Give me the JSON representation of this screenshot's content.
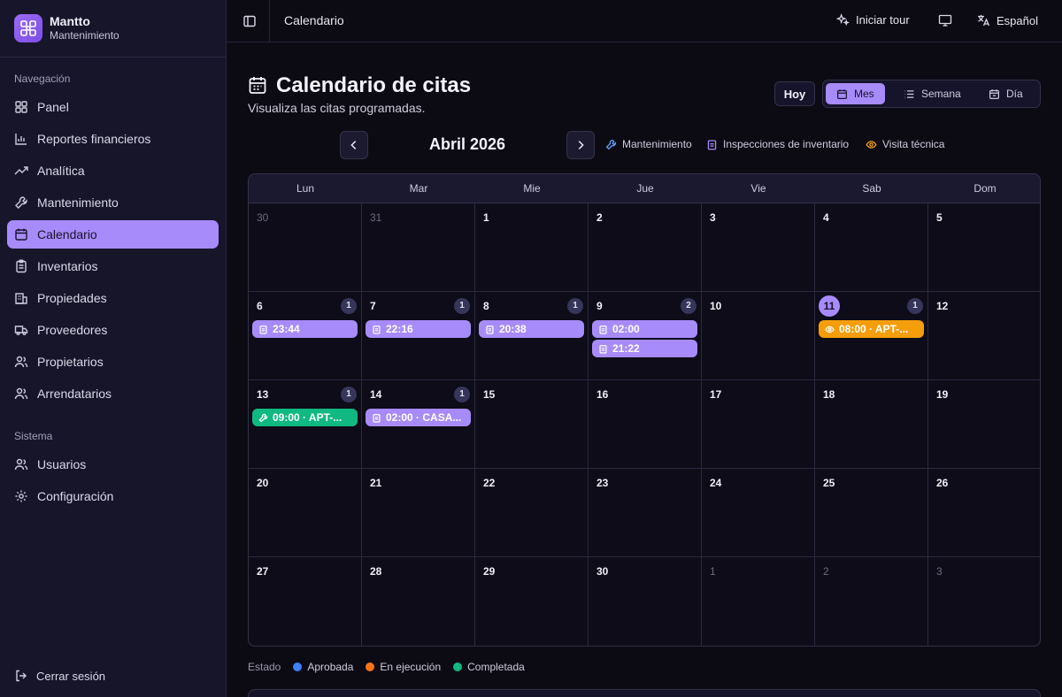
{
  "brand": {
    "name": "Mantto",
    "subtitle": "Mantenimiento"
  },
  "sidebar": {
    "group_navigation": "Navegación",
    "group_system": "Sistema",
    "items": [
      {
        "label": "Panel",
        "icon": "grid-icon"
      },
      {
        "label": "Reportes financieros",
        "icon": "bar-chart-icon"
      },
      {
        "label": "Analítica",
        "icon": "trending-icon"
      },
      {
        "label": "Mantenimiento",
        "icon": "wrench-icon"
      },
      {
        "label": "Calendario",
        "icon": "calendar-icon",
        "active": true
      },
      {
        "label": "Inventarios",
        "icon": "clipboard-icon"
      },
      {
        "label": "Propiedades",
        "icon": "building-icon"
      },
      {
        "label": "Proveedores",
        "icon": "truck-icon"
      },
      {
        "label": "Propietarios",
        "icon": "users-icon"
      },
      {
        "label": "Arrendatarios",
        "icon": "users-icon"
      }
    ],
    "system_items": [
      {
        "label": "Usuarios",
        "icon": "users-icon"
      },
      {
        "label": "Configuración",
        "icon": "gear-icon"
      }
    ],
    "logout": "Cerrar sesión"
  },
  "topbar": {
    "title": "Calendario",
    "tour": "Iniciar tour",
    "language": "Español"
  },
  "page": {
    "title": "Calendario de citas",
    "subtitle": "Visualiza las citas programadas."
  },
  "controls": {
    "today": "Hoy",
    "views": [
      "Mes",
      "Semana",
      "Día"
    ],
    "active_view": "Mes"
  },
  "month": {
    "label": "Abril 2026"
  },
  "legend": [
    {
      "label": "Mantenimiento",
      "icon": "wrench-icon",
      "color": "#60a5fa"
    },
    {
      "label": "Inspecciones de inventario",
      "icon": "clipboard-icon",
      "color": "#a78bfa"
    },
    {
      "label": "Visita técnica",
      "icon": "eye-icon",
      "color": "#f59e0b"
    }
  ],
  "calendar": {
    "weekdays": [
      "Lun",
      "Mar",
      "Mie",
      "Jue",
      "Vie",
      "Sab",
      "Dom"
    ],
    "weeks": [
      [
        {
          "day": "30",
          "muted": true
        },
        {
          "day": "31",
          "muted": true
        },
        {
          "day": "1"
        },
        {
          "day": "2"
        },
        {
          "day": "3"
        },
        {
          "day": "4"
        },
        {
          "day": "5"
        }
      ],
      [
        {
          "day": "6",
          "count": "1",
          "events": [
            {
              "type": "inspection",
              "label": "23:44"
            }
          ]
        },
        {
          "day": "7",
          "count": "1",
          "events": [
            {
              "type": "inspection",
              "label": "22:16"
            }
          ]
        },
        {
          "day": "8",
          "count": "1",
          "events": [
            {
              "type": "inspection",
              "label": "20:38"
            }
          ]
        },
        {
          "day": "9",
          "count": "2",
          "events": [
            {
              "type": "inspection",
              "label": "02:00"
            },
            {
              "type": "inspection",
              "label": "21:22"
            }
          ]
        },
        {
          "day": "10"
        },
        {
          "day": "11",
          "today": true,
          "count": "1",
          "events": [
            {
              "type": "visit",
              "label": "08:00 · APT-..."
            }
          ]
        },
        {
          "day": "12"
        }
      ],
      [
        {
          "day": "13",
          "count": "1",
          "events": [
            {
              "type": "maint",
              "label": "09:00 · APT-..."
            }
          ]
        },
        {
          "day": "14",
          "count": "1",
          "events": [
            {
              "type": "inspection",
              "label": "02:00 · CASA..."
            }
          ]
        },
        {
          "day": "15"
        },
        {
          "day": "16"
        },
        {
          "day": "17"
        },
        {
          "day": "18"
        },
        {
          "day": "19"
        }
      ],
      [
        {
          "day": "20"
        },
        {
          "day": "21"
        },
        {
          "day": "22"
        },
        {
          "day": "23"
        },
        {
          "day": "24"
        },
        {
          "day": "25"
        },
        {
          "day": "26"
        }
      ],
      [
        {
          "day": "27"
        },
        {
          "day": "28"
        },
        {
          "day": "29"
        },
        {
          "day": "30"
        },
        {
          "day": "1",
          "muted": true
        },
        {
          "day": "2",
          "muted": true
        },
        {
          "day": "3",
          "muted": true
        }
      ]
    ]
  },
  "status_legend": {
    "label": "Estado",
    "items": [
      {
        "label": "Aprobada",
        "color": "#3b82f6"
      },
      {
        "label": "En ejecución",
        "color": "#f97316"
      },
      {
        "label": "Completada",
        "color": "#10b981"
      }
    ]
  }
}
